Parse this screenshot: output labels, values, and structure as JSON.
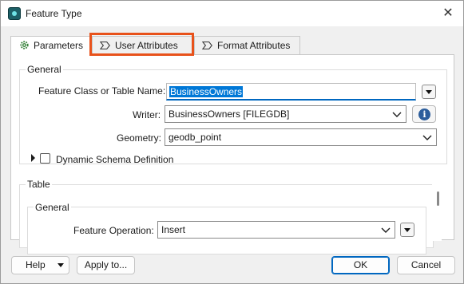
{
  "window": {
    "title": "Feature Type",
    "close_glyph": "✕",
    "app_icon": "fme-app-icon"
  },
  "tabs": [
    {
      "label": "Parameters",
      "icon": "gear-icon",
      "active": true
    },
    {
      "label": "User Attributes",
      "icon": "attribute-tag-icon",
      "active": false,
      "highlighted": true
    },
    {
      "label": "Format Attributes",
      "icon": "attribute-tag-icon",
      "active": false
    }
  ],
  "colors": {
    "highlight_outline": "#e8521b",
    "accent": "#0067c0",
    "selection": "#0078d7",
    "info_icon": "#2c5d9c"
  },
  "general": {
    "title": "General",
    "feature_class_label": "Feature Class or Table Name:",
    "feature_class_value": "BusinessOwners",
    "writer_label": "Writer:",
    "writer_value": "BusinessOwners [FILEGDB]",
    "geometry_label": "Geometry:",
    "geometry_value": "geodb_point",
    "dynamic_schema_label": "Dynamic Schema Definition",
    "dynamic_schema_checked": false
  },
  "table": {
    "title": "Table",
    "general_title": "General",
    "feature_operation_label": "Feature Operation:",
    "feature_operation_value": "Insert"
  },
  "footer": {
    "help_label": "Help",
    "apply_to_label": "Apply to...",
    "ok_label": "OK",
    "cancel_label": "Cancel"
  }
}
